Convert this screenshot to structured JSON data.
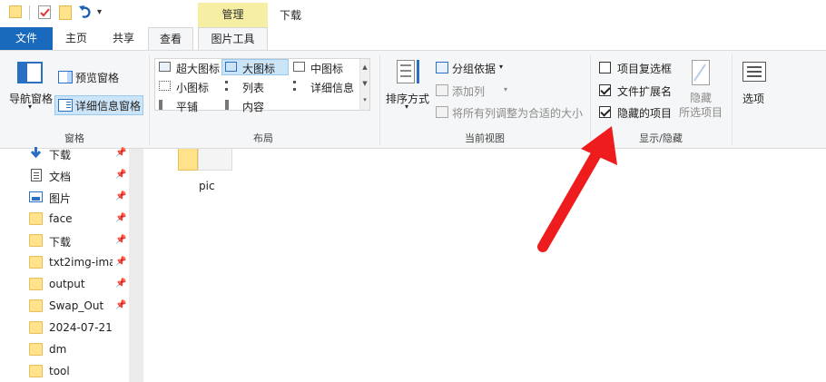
{
  "window": {
    "contextual_tab": "管理",
    "title": "下载"
  },
  "tabs": [
    {
      "label": "文件"
    },
    {
      "label": "主页"
    },
    {
      "label": "共享"
    },
    {
      "label": "查看"
    },
    {
      "label": "图片工具"
    }
  ],
  "ribbon": {
    "panes": {
      "group_label": "窗格",
      "nav_pane": "导航窗格",
      "preview_pane": "预览窗格",
      "details_pane": "详细信息窗格"
    },
    "layout": {
      "group_label": "布局",
      "options": [
        "超大图标",
        "大图标",
        "中图标",
        "小图标",
        "列表",
        "详细信息",
        "平铺",
        "内容"
      ],
      "selected": "大图标"
    },
    "current_view": {
      "group_label": "当前视图",
      "sort_by": "排序方式",
      "group_by": "分组依据",
      "add_columns": "添加列",
      "size_columns": "将所有列调整为合适的大小"
    },
    "show_hide": {
      "group_label": "显示/隐藏",
      "item_checkboxes": {
        "label": "项目复选框",
        "checked": false
      },
      "file_extensions": {
        "label": "文件扩展名",
        "checked": true
      },
      "hidden_items": {
        "label": "隐藏的项目",
        "checked": true
      },
      "hide_selected": "隐藏\n所选项目"
    },
    "options_label": "选项"
  },
  "nav": {
    "items": [
      {
        "label": "下载",
        "icon": "download-arrow-icon"
      },
      {
        "label": "文档",
        "icon": "document-icon"
      },
      {
        "label": "图片",
        "icon": "pictures-icon"
      },
      {
        "label": "face",
        "icon": "folder-icon"
      },
      {
        "label": "下载",
        "icon": "folder-icon"
      },
      {
        "label": "txt2img-ima",
        "icon": "folder-icon"
      },
      {
        "label": "output",
        "icon": "folder-icon"
      },
      {
        "label": "Swap_Out",
        "icon": "folder-icon"
      },
      {
        "label": "2024-07-21",
        "icon": "folder-icon"
      },
      {
        "label": "dm",
        "icon": "folder-icon"
      },
      {
        "label": "tool",
        "icon": "folder-icon"
      }
    ]
  },
  "content": {
    "items": [
      {
        "label": "pic"
      }
    ]
  },
  "colors": {
    "file_tab": "#1969bd",
    "contextual_tab": "#f5eea3",
    "annotation_arrow": "#ee1c1c",
    "selection": "#cce4f7"
  }
}
